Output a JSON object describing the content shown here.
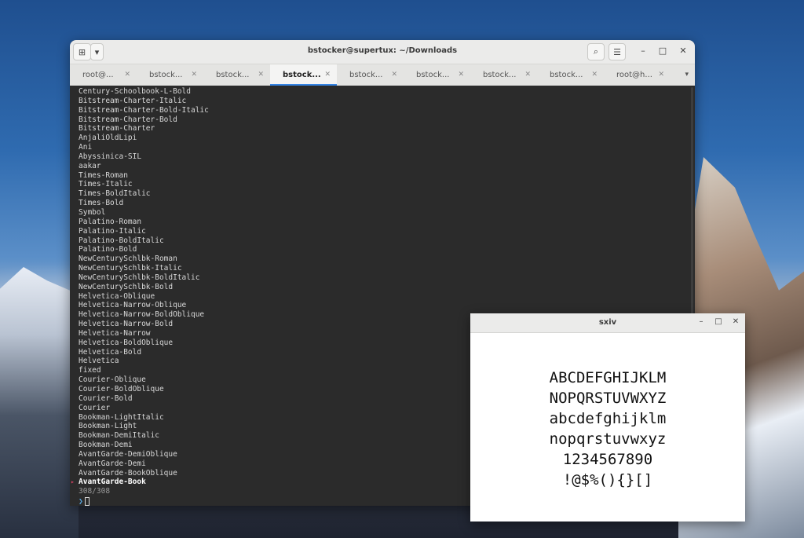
{
  "terminal": {
    "title": "bstocker@supertux: ~/Downloads",
    "new_tab_glyph": "⊞",
    "menu_glyph": "▾",
    "search_glyph": "⌕",
    "hamburger_glyph": "☰",
    "minimize_glyph": "–",
    "maximize_glyph": "□",
    "close_glyph": "✕",
    "tabs": [
      {
        "label": "root@...",
        "active": false
      },
      {
        "label": "bstock...",
        "active": false
      },
      {
        "label": "bstock...",
        "active": false
      },
      {
        "label": "bstock...",
        "active": true
      },
      {
        "label": "bstock...",
        "active": false
      },
      {
        "label": "bstock...",
        "active": false
      },
      {
        "label": "bstock...",
        "active": false
      },
      {
        "label": "bstock...",
        "active": false
      },
      {
        "label": "root@h...",
        "active": false
      }
    ],
    "tab_close_glyph": "✕",
    "tab_overflow_glyph": "▾",
    "lines": [
      "Century-Schoolbook-L-Bold",
      "Bitstream-Charter-Italic",
      "Bitstream-Charter-Bold-Italic",
      "Bitstream-Charter-Bold",
      "Bitstream-Charter",
      "AnjaliOldLipi",
      "Ani",
      "Abyssinica-SIL",
      "aakar",
      "Times-Roman",
      "Times-Italic",
      "Times-BoldItalic",
      "Times-Bold",
      "Symbol",
      "Palatino-Roman",
      "Palatino-Italic",
      "Palatino-BoldItalic",
      "Palatino-Bold",
      "NewCenturySchlbk-Roman",
      "NewCenturySchlbk-Italic",
      "NewCenturySchlbk-BoldItalic",
      "NewCenturySchlbk-Bold",
      "Helvetica-Oblique",
      "Helvetica-Narrow-Oblique",
      "Helvetica-Narrow-BoldOblique",
      "Helvetica-Narrow-Bold",
      "Helvetica-Narrow",
      "Helvetica-BoldOblique",
      "Helvetica-Bold",
      "Helvetica",
      "fixed",
      "Courier-Oblique",
      "Courier-BoldOblique",
      "Courier-Bold",
      "Courier",
      "Bookman-LightItalic",
      "Bookman-Light",
      "Bookman-DemiItalic",
      "Bookman-Demi",
      "AvantGarde-DemiOblique",
      "AvantGarde-Demi",
      "AvantGarde-BookOblique"
    ],
    "selected_line": "AvantGarde-Book",
    "selection_marker": "▸",
    "match_count": "308/308",
    "prompt_glyph": "❯"
  },
  "sxiv": {
    "title": "sxiv",
    "minimize_glyph": "–",
    "maximize_glyph": "□",
    "close_glyph": "✕",
    "sample_lines": [
      "ABCDEFGHIJKLM",
      "NOPQRSTUVWXYZ",
      "abcdefghijklm",
      "nopqrstuvwxyz",
      "1234567890",
      "!@$%(){}[]"
    ]
  },
  "colors": {
    "accent": "#3584e4",
    "terminal_bg": "#2b2b2b",
    "selection_marker": "#d04060",
    "prompt": "#5aa7e0"
  }
}
